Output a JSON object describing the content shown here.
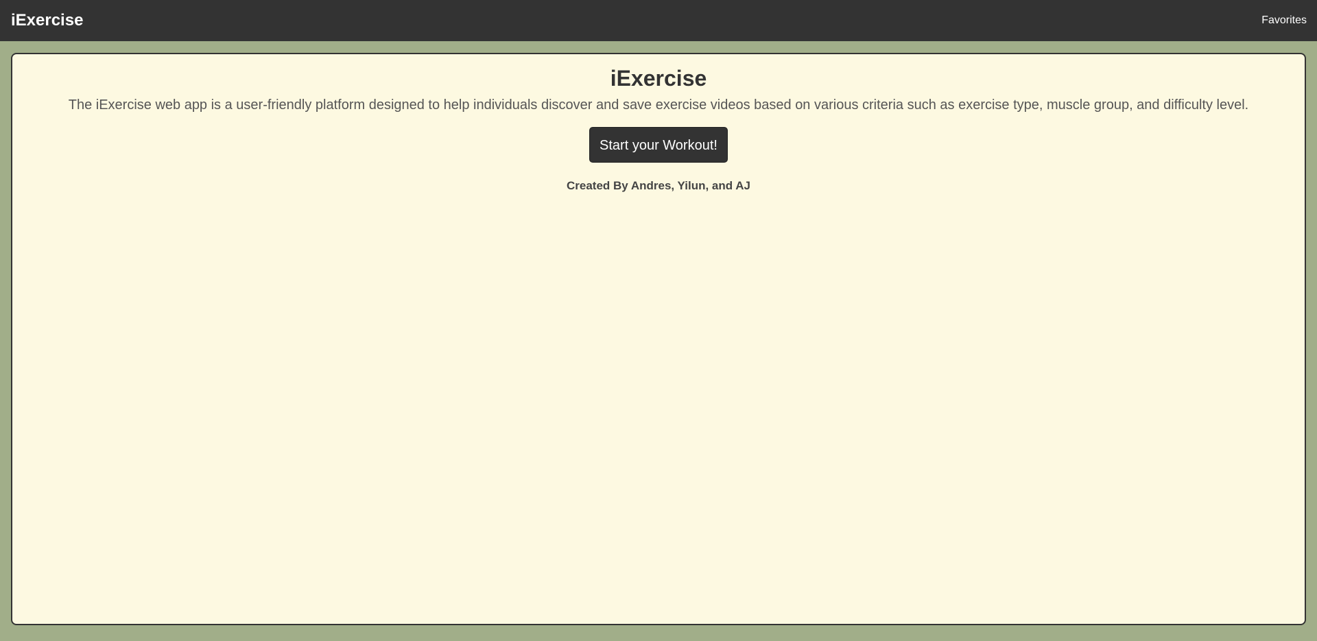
{
  "navbar": {
    "brand": "iExercise",
    "links": [
      {
        "label": "Favorites"
      }
    ]
  },
  "main": {
    "title": "iExercise",
    "description": "The iExercise web app is a user-friendly platform designed to help individuals discover and save exercise videos based on various criteria such as exercise type, muscle group, and difficulty level.",
    "cta_label": "Start your Workout!",
    "credits": "Created By Andres, Yilun, and AJ"
  },
  "colors": {
    "navbar_bg": "#333333",
    "page_bg": "#a1ae89",
    "card_bg": "#fdf9e1",
    "button_bg": "#333333"
  }
}
